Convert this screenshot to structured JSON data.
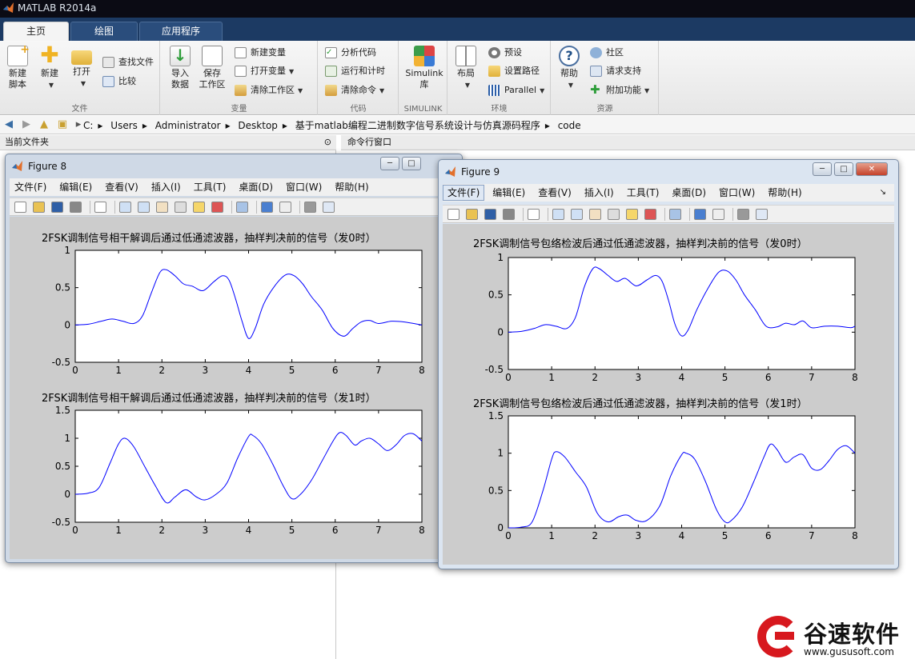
{
  "app": {
    "title": "MATLAB R2014a"
  },
  "tabs": [
    {
      "label": "主页",
      "active": true
    },
    {
      "label": "绘图",
      "active": false
    },
    {
      "label": "应用程序",
      "active": false
    }
  ],
  "ribbon": {
    "file": {
      "label": "文件",
      "new_script": "新建\n脚本",
      "new": "新建",
      "open": "打开",
      "find_files": "查找文件",
      "compare": "比较"
    },
    "variable": {
      "label": "变量",
      "import_data": "导入\n数据",
      "save_workspace": "保存\n工作区",
      "new_variable": "新建变量",
      "open_variable": "打开变量",
      "clear_workspace": "清除工作区"
    },
    "code": {
      "label": "代码",
      "analyze_code": "分析代码",
      "run_and_time": "运行和计时",
      "clear_commands": "清除命令"
    },
    "simulink": {
      "label": "SIMULINK",
      "library": "Simulink\n库"
    },
    "environment": {
      "label": "环境",
      "layout": "布局",
      "preferences": "预设",
      "set_path": "设置路径",
      "parallel": "Parallel"
    },
    "resources": {
      "label": "资源",
      "help": "帮助",
      "community": "社区",
      "request_support": "请求支持",
      "addons": "附加功能"
    }
  },
  "address": {
    "path": [
      "C:",
      "Users",
      "Administrator",
      "Desktop",
      "基于matlab编程二进制数字信号系统设计与仿真源码程序",
      "code"
    ]
  },
  "panels": {
    "current_folder": "当前文件夹",
    "command_window": "命令行窗口"
  },
  "figure8": {
    "title": "Figure 8",
    "menu": [
      "文件(F)",
      "编辑(E)",
      "查看(V)",
      "插入(I)",
      "工具(T)",
      "桌面(D)",
      "窗口(W)",
      "帮助(H)"
    ],
    "plot1_title": "2FSK调制信号相干解调后通过低通滤波器，抽样判决前的信号（发0时）",
    "plot2_title": "2FSK调制信号相干解调后通过低通滤波器，抽样判决前的信号（发1时）"
  },
  "figure9": {
    "title": "Figure 9",
    "menu": [
      "文件(F)",
      "编辑(E)",
      "查看(V)",
      "插入(I)",
      "工具(T)",
      "桌面(D)",
      "窗口(W)",
      "帮助(H)"
    ],
    "plot1_title": "2FSK调制信号包络检波后通过低通滤波器，抽样判决前的信号（发0时）",
    "plot2_title": "2FSK调制信号包络检波后通过低通滤波器，抽样判决前的信号（发1时）"
  },
  "watermark": {
    "name": "谷速软件",
    "url": "www.gususoft.com"
  },
  "colors": {
    "line": "#0000ff",
    "figure_bg": "#cccccc",
    "tab_bar": "#1c3a63",
    "watermark_red": "#d7181e"
  },
  "chart_data": [
    {
      "type": "line",
      "title": "2FSK调制信号相干解调后通过低通滤波器，抽样判决前的信号（发0时）",
      "xlim": [
        0,
        8
      ],
      "ylim": [
        -0.5,
        1
      ],
      "xticks": [
        "0",
        "1",
        "2",
        "3",
        "4",
        "5",
        "6",
        "7",
        "8"
      ],
      "yticks": [
        "-0.5",
        "0",
        "0.5",
        "1"
      ],
      "x": [
        0,
        0.3,
        0.6,
        0.85,
        1.1,
        1.35,
        1.55,
        1.75,
        1.95,
        2.1,
        2.3,
        2.5,
        2.7,
        2.95,
        3.2,
        3.4,
        3.55,
        3.7,
        3.85,
        4.0,
        4.15,
        4.35,
        4.6,
        4.85,
        5.05,
        5.25,
        5.45,
        5.7,
        5.95,
        6.2,
        6.4,
        6.6,
        6.8,
        7.0,
        7.3,
        7.6,
        7.9,
        8.0
      ],
      "y": [
        0,
        0.01,
        0.05,
        0.08,
        0.05,
        0.02,
        0.12,
        0.42,
        0.7,
        0.74,
        0.66,
        0.55,
        0.52,
        0.46,
        0.58,
        0.66,
        0.6,
        0.35,
        0.05,
        -0.18,
        -0.05,
        0.28,
        0.52,
        0.67,
        0.66,
        0.55,
        0.38,
        0.2,
        -0.05,
        -0.15,
        -0.05,
        0.04,
        0.06,
        0.02,
        0.05,
        0.04,
        0.01,
        0.0
      ]
    },
    {
      "type": "line",
      "title": "2FSK调制信号相干解调后通过低通滤波器，抽样判决前的信号（发1时）",
      "xlim": [
        0,
        8
      ],
      "ylim": [
        -0.5,
        1.5
      ],
      "xticks": [
        "0",
        "1",
        "2",
        "3",
        "4",
        "5",
        "6",
        "7",
        "8"
      ],
      "yticks": [
        "-0.5",
        "0",
        "0.5",
        "1",
        "1.5"
      ],
      "x": [
        0,
        0.3,
        0.55,
        0.8,
        1.0,
        1.15,
        1.35,
        1.6,
        1.85,
        2.1,
        2.3,
        2.55,
        2.8,
        3.0,
        3.25,
        3.5,
        3.75,
        4.0,
        4.1,
        4.3,
        4.55,
        4.8,
        5.0,
        5.2,
        5.45,
        5.7,
        5.95,
        6.1,
        6.25,
        6.45,
        6.6,
        6.8,
        7.0,
        7.2,
        7.4,
        7.6,
        7.8,
        8.0
      ],
      "y": [
        0,
        0.02,
        0.12,
        0.55,
        0.9,
        1.0,
        0.85,
        0.5,
        0.15,
        -0.15,
        -0.05,
        0.08,
        -0.05,
        -0.1,
        0.0,
        0.2,
        0.65,
        1.03,
        1.05,
        0.9,
        0.55,
        0.15,
        -0.08,
        0.0,
        0.25,
        0.6,
        0.95,
        1.1,
        1.05,
        0.88,
        0.95,
        1.0,
        0.9,
        0.78,
        0.88,
        1.05,
        1.08,
        0.95
      ]
    },
    {
      "type": "line",
      "title": "2FSK调制信号包络检波后通过低通滤波器，抽样判决前的信号（发0时）",
      "xlim": [
        0,
        8
      ],
      "ylim": [
        -0.5,
        1
      ],
      "xticks": [
        "0",
        "1",
        "2",
        "3",
        "4",
        "5",
        "6",
        "7",
        "8"
      ],
      "yticks": [
        "-0.5",
        "0",
        "0.5",
        "1"
      ],
      "x": [
        0,
        0.3,
        0.6,
        0.85,
        1.1,
        1.35,
        1.55,
        1.75,
        1.95,
        2.1,
        2.3,
        2.5,
        2.7,
        2.95,
        3.2,
        3.4,
        3.55,
        3.7,
        3.85,
        4.0,
        4.15,
        4.35,
        4.6,
        4.85,
        5.05,
        5.25,
        5.45,
        5.7,
        5.95,
        6.2,
        6.4,
        6.6,
        6.8,
        7.0,
        7.3,
        7.6,
        7.9,
        8.0
      ],
      "y": [
        0,
        0.01,
        0.05,
        0.1,
        0.08,
        0.05,
        0.2,
        0.6,
        0.85,
        0.85,
        0.76,
        0.68,
        0.72,
        0.62,
        0.7,
        0.76,
        0.68,
        0.42,
        0.1,
        -0.05,
        0.03,
        0.3,
        0.58,
        0.8,
        0.82,
        0.7,
        0.5,
        0.3,
        0.08,
        0.07,
        0.12,
        0.1,
        0.15,
        0.06,
        0.08,
        0.08,
        0.06,
        0.08
      ]
    },
    {
      "type": "line",
      "title": "2FSK调制信号包络检波后通过低通滤波器，抽样判决前的信号（发1时）",
      "xlim": [
        0,
        8
      ],
      "ylim": [
        0,
        1.5
      ],
      "xticks": [
        "0",
        "1",
        "2",
        "3",
        "4",
        "5",
        "6",
        "7",
        "8"
      ],
      "yticks": [
        "0",
        "0.5",
        "1",
        "1.5"
      ],
      "x": [
        0,
        0.3,
        0.55,
        0.8,
        1.0,
        1.1,
        1.3,
        1.55,
        1.8,
        2.05,
        2.3,
        2.55,
        2.75,
        2.95,
        3.2,
        3.5,
        3.75,
        4.0,
        4.1,
        4.3,
        4.55,
        4.8,
        5.0,
        5.15,
        5.4,
        5.65,
        5.9,
        6.05,
        6.2,
        6.4,
        6.6,
        6.8,
        7.0,
        7.2,
        7.4,
        7.6,
        7.8,
        8.0
      ],
      "y": [
        0,
        0.01,
        0.08,
        0.5,
        0.92,
        1.02,
        0.95,
        0.75,
        0.55,
        0.2,
        0.08,
        0.15,
        0.17,
        0.1,
        0.1,
        0.3,
        0.7,
        0.98,
        1.0,
        0.92,
        0.62,
        0.25,
        0.08,
        0.1,
        0.28,
        0.6,
        0.95,
        1.12,
        1.05,
        0.88,
        0.95,
        0.98,
        0.8,
        0.78,
        0.9,
        1.05,
        1.1,
        1.0
      ]
    }
  ]
}
